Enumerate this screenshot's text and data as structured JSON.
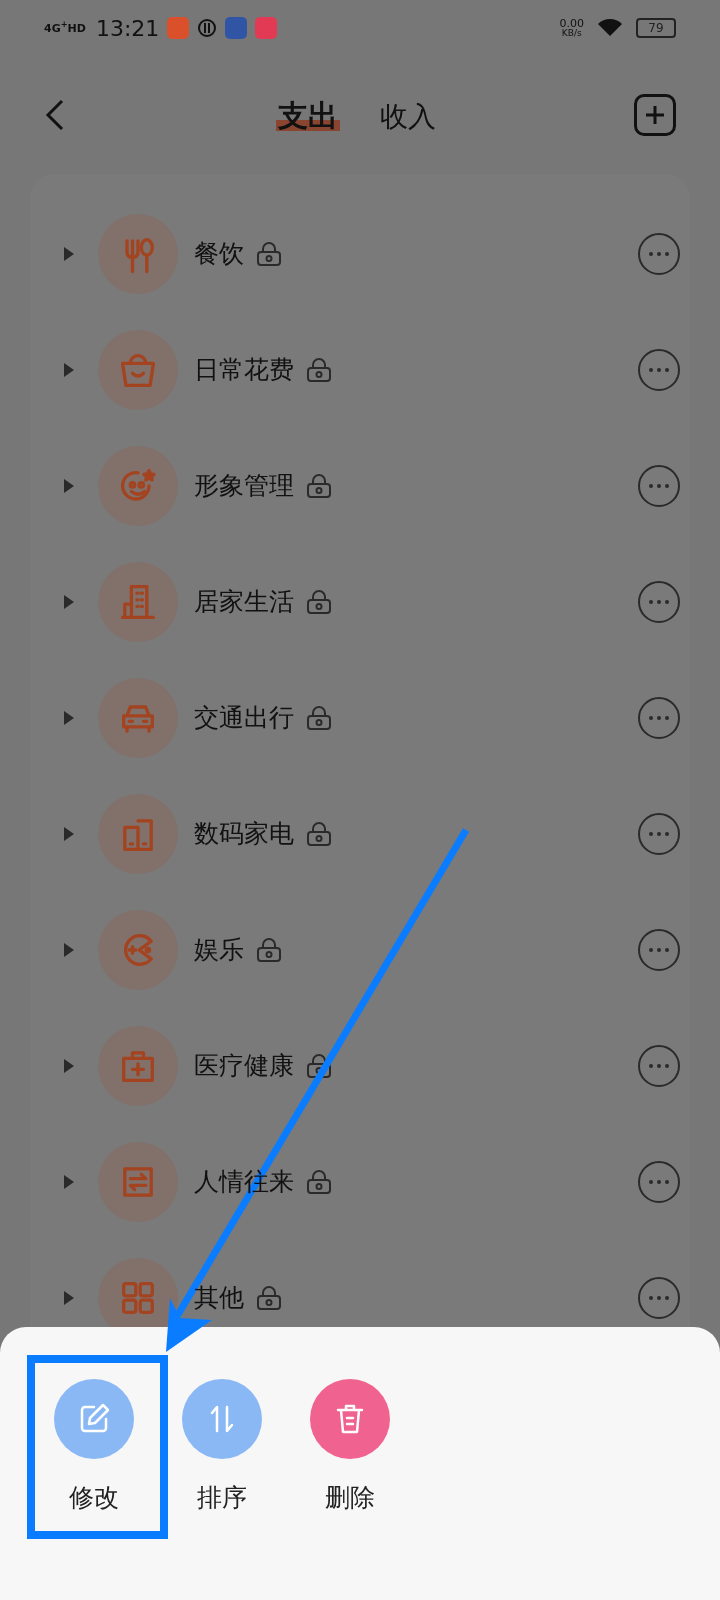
{
  "status_bar": {
    "network": "4G$^{+}$HD",
    "time": "13:21",
    "speed": "0.00",
    "speed_unit": "KB/s",
    "battery": "79"
  },
  "tabs": [
    {
      "label": "支出",
      "selected": true
    },
    {
      "label": "收入",
      "selected": false
    }
  ],
  "categories": [
    {
      "label": "餐饮",
      "locked": true
    },
    {
      "label": "日常花费",
      "locked": true
    },
    {
      "label": "形象管理",
      "locked": true
    },
    {
      "label": "居家生活",
      "locked": true
    },
    {
      "label": "交通出行",
      "locked": true
    },
    {
      "label": "数码家电",
      "locked": true
    },
    {
      "label": "娱乐",
      "locked": true
    },
    {
      "label": "医疗健康",
      "locked": true
    },
    {
      "label": "人情往来",
      "locked": true
    },
    {
      "label": "其他",
      "locked": true
    }
  ],
  "actions": [
    {
      "label": "修改",
      "kind": "edit"
    },
    {
      "label": "排序",
      "kind": "sort"
    },
    {
      "label": "删除",
      "kind": "delete"
    }
  ]
}
